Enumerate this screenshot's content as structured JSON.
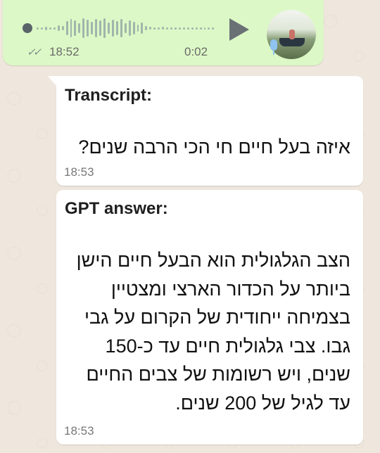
{
  "voice_message": {
    "time": "18:52",
    "duration": "0:02",
    "status_icon": "double-check-icon",
    "play_icon": "play-icon",
    "mic_icon": "microphone-icon"
  },
  "transcript": {
    "label": "Transcript:",
    "text": "איזה בעל חיים חי הכי הרבה שנים?",
    "time": "18:53"
  },
  "gpt": {
    "label": "GPT answer:",
    "text": "הצב הגלגולית הוא הבעל חיים הישן ביותר על הכדור הארצי ומצטיין בצמיחה ייחודית של הקרום על גבי גבו. צבי גלגולית חיים עד כ-150 שנים, ויש רשומות של צבים החיים עד לגיל של 200 שנים.",
    "time": "18:53"
  },
  "colors": {
    "outgoing_bubble": "#dcf8c6",
    "incoming_bubble": "#ffffff",
    "background": "#efe7dd"
  }
}
